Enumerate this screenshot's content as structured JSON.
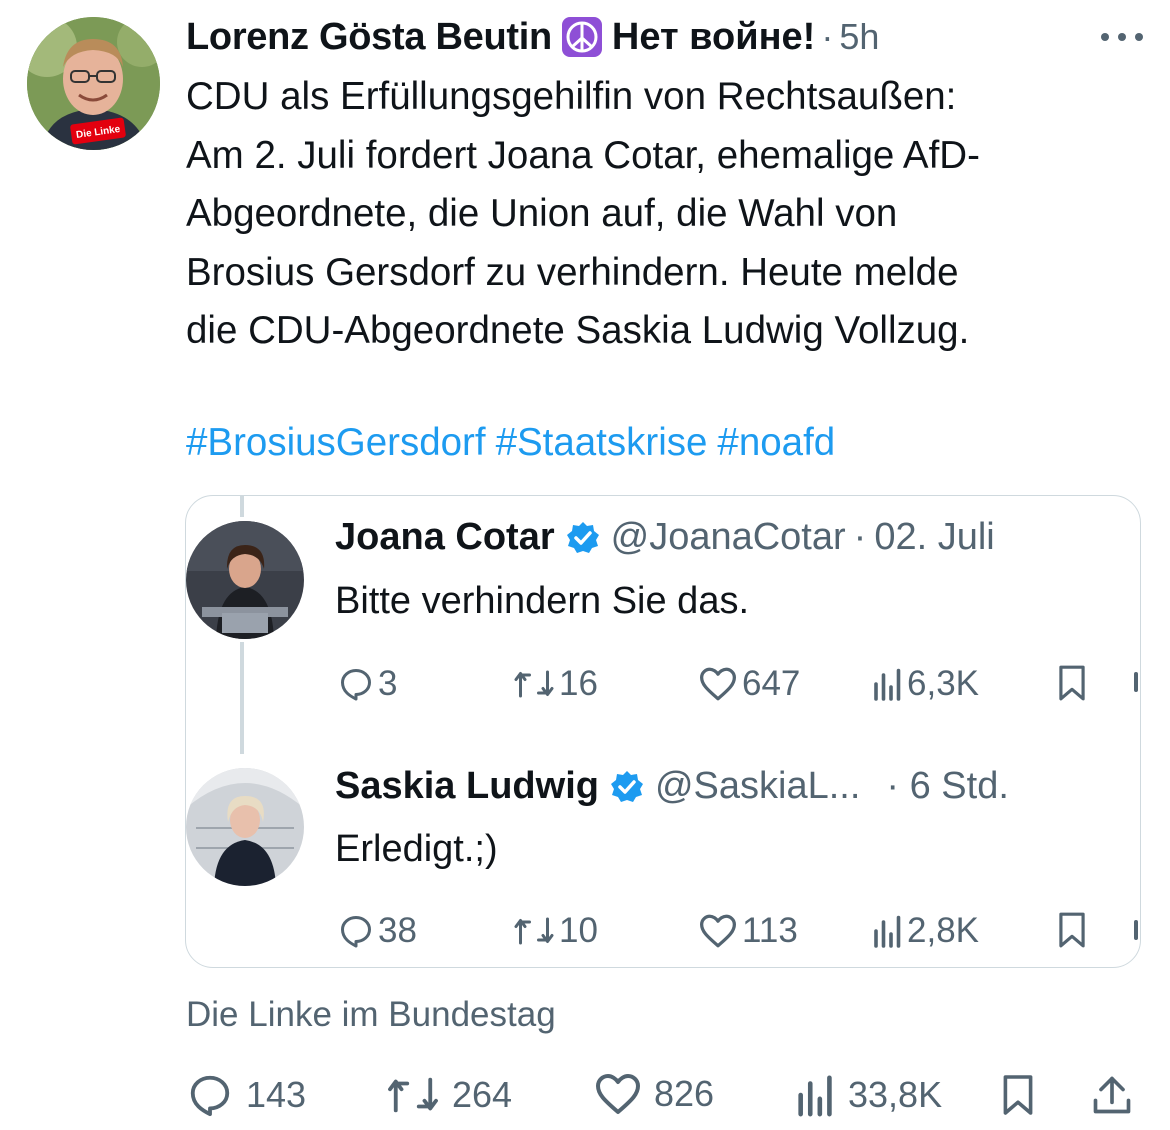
{
  "tweet": {
    "author_name": "Lorenz Gösta Beutin",
    "author_suffix": "Нет войне!",
    "separator": "·",
    "time": "5h",
    "avatar_badge": "Die Linke",
    "text_lines": [
      "CDU als Erfüllungsgehilfin von Rechtsaußen:",
      "Am 2. Juli fordert Joana Cotar, ehemalige AfD-",
      "Abgeordnete, die Union auf, die Wahl von",
      "Brosius Gersdorf zu verhindern. Heute melde",
      "die CDU-Abgeordnete Saskia Ludwig Vollzug."
    ],
    "hashtags": [
      "#BrosiusGersdorf",
      "#Staatskrise",
      "#noafd"
    ],
    "source": "Die Linke im Bundestag",
    "stats": {
      "replies": "143",
      "reposts": "264",
      "likes": "826",
      "views": "33,8K"
    }
  },
  "quote": {
    "first": {
      "name": "Joana Cotar",
      "handle": "@JoanaCotar",
      "separator": "·",
      "date": "02. Juli",
      "text": "Bitte verhindern Sie das.",
      "stats": {
        "replies": "3",
        "reposts": "16",
        "likes": "647",
        "views": "6,3K"
      }
    },
    "second": {
      "name": "Saskia Ludwig",
      "handle": "@SaskiaL...",
      "date": "· 6 Std.",
      "text": "Erledigt.;)",
      "stats": {
        "replies": "38",
        "reposts": "10",
        "likes": "113",
        "views": "2,8K"
      }
    }
  },
  "colors": {
    "text": "#0f1419",
    "muted": "#536471",
    "link": "#1d9bf0",
    "border": "#cfd9de",
    "verified": "#1d9bf0",
    "badge": "#8e4fd6",
    "party": "#e3000f"
  },
  "icons": [
    "more-icon",
    "peace-icon",
    "verified-icon",
    "reply-icon",
    "repost-icon",
    "like-icon",
    "views-icon",
    "bookmark-icon",
    "share-icon"
  ]
}
